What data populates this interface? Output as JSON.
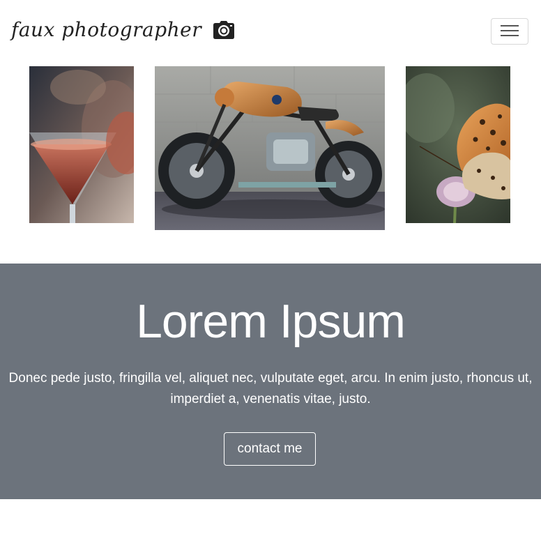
{
  "navbar": {
    "brand": "faux photographer",
    "brand_icon": "camera-icon",
    "toggler_icon": "hamburger-menu-icon"
  },
  "gallery": {
    "photos": [
      {
        "subject": "cocktail-glasses"
      },
      {
        "subject": "vintage-motorcycle"
      },
      {
        "subject": "butterfly-on-flower"
      }
    ]
  },
  "hero": {
    "title": "Lorem Ipsum",
    "text": "Donec pede justo, fringilla vel, aliquet nec, vulputate eget, arcu. In enim justo, rhoncus ut, imperdiet a, venenatis vitae, justo.",
    "button_label": "contact me",
    "background": "#6c737c"
  }
}
